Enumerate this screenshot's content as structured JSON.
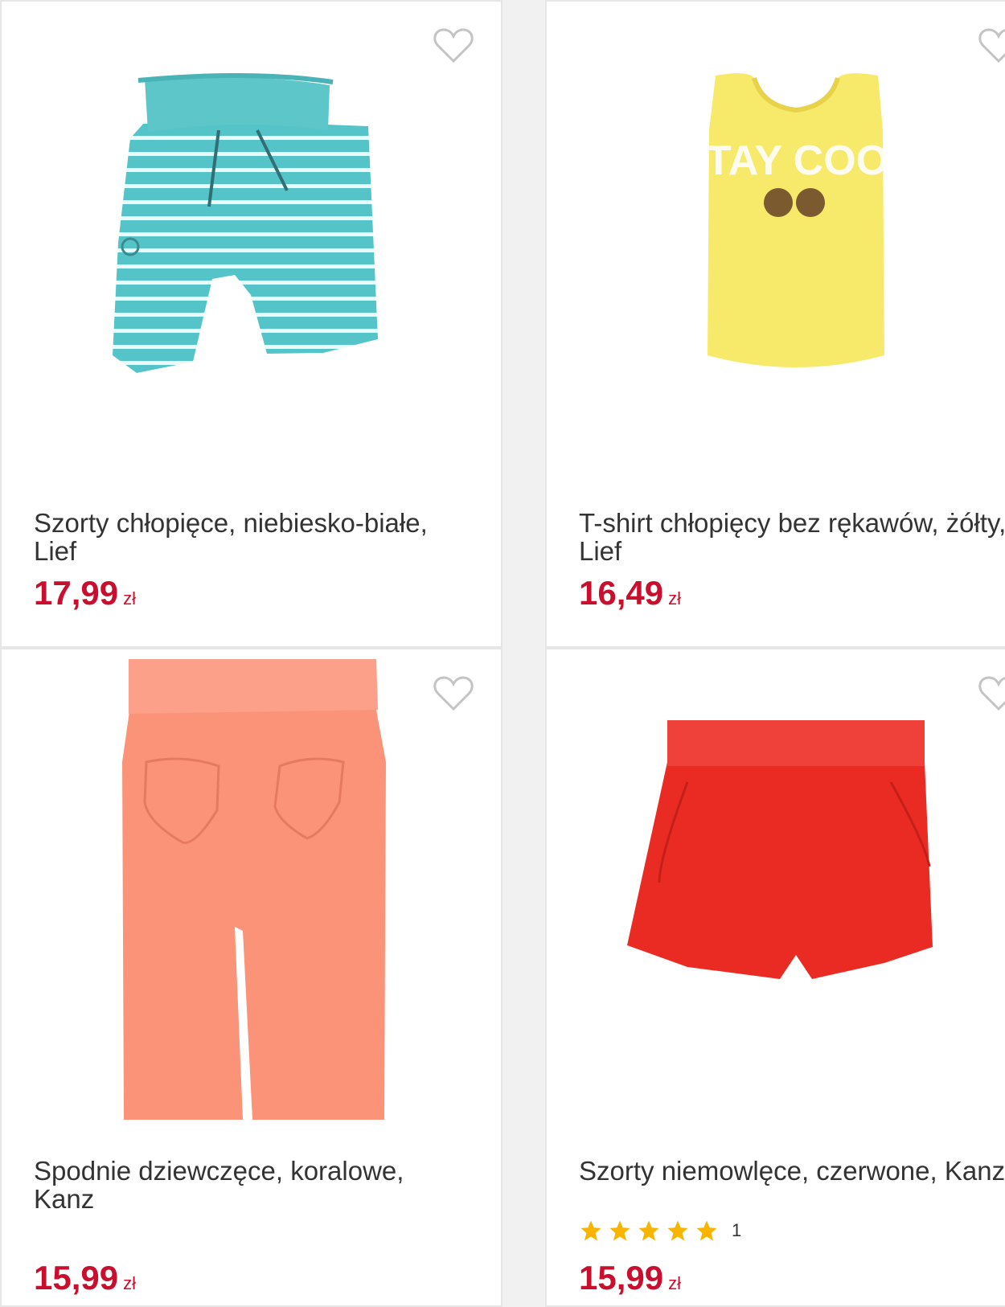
{
  "products": [
    {
      "title": "Szorty chłopięce, niebiesko-białe, Lief",
      "price": "17,99",
      "currency": "zł",
      "icon": "heart-outline-icon"
    },
    {
      "title": "T-shirt chłopięcy bez rękawów, żółty, Lief",
      "price": "16,49",
      "currency": "zł",
      "icon": "heart-outline-icon",
      "image_print": "STAY COOL"
    },
    {
      "title": "Spodnie dziewczęce, koralowe, Kanz",
      "price": "15,99",
      "currency": "zł",
      "icon": "heart-outline-icon"
    },
    {
      "title": "Szorty niemowlęce, czerwone, Kanz",
      "price": "15,99",
      "currency": "zł",
      "icon": "heart-outline-icon",
      "rating": {
        "stars": 5,
        "count": "1"
      }
    }
  ],
  "colors": {
    "price": "#c8102e",
    "star": "#f7b500",
    "heart": "#c4c4c4"
  }
}
